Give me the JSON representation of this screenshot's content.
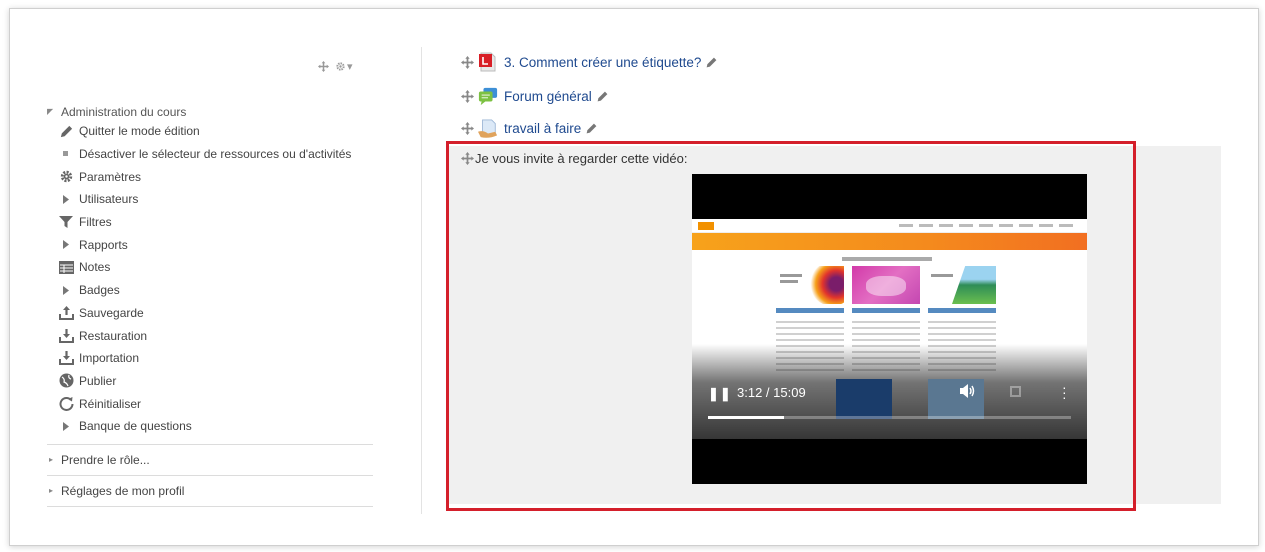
{
  "sidebar": {
    "section_title": "Administration du cours",
    "items": [
      {
        "label": "Quitter le mode édition",
        "icon": "pencil-icon"
      },
      {
        "label": "Désactiver le sélecteur de ressources ou d'activités",
        "icon": "bullet-icon"
      },
      {
        "label": "Paramètres",
        "icon": "gear-icon"
      },
      {
        "label": "Utilisateurs",
        "icon": "caret-right-icon"
      },
      {
        "label": "Filtres",
        "icon": "filter-icon"
      },
      {
        "label": "Rapports",
        "icon": "caret-right-icon"
      },
      {
        "label": "Notes",
        "icon": "grades-table-icon"
      },
      {
        "label": "Badges",
        "icon": "caret-right-icon"
      },
      {
        "label": "Sauvegarde",
        "icon": "upload-icon"
      },
      {
        "label": "Restauration",
        "icon": "download-icon"
      },
      {
        "label": "Importation",
        "icon": "download-icon"
      },
      {
        "label": "Publier",
        "icon": "globe-icon"
      },
      {
        "label": "Réinitialiser",
        "icon": "reset-icon"
      },
      {
        "label": "Banque de questions",
        "icon": "caret-right-icon"
      }
    ],
    "switch_role": "Prendre le rôle...",
    "profile_settings": "Réglages de mon profil"
  },
  "content": {
    "activities": [
      {
        "label": "3. Comment créer une étiquette?",
        "icon": "pdf-icon"
      },
      {
        "label": "Forum général",
        "icon": "forum-icon"
      },
      {
        "label": "travail à faire",
        "icon": "assignment-icon"
      }
    ],
    "label_text": "Je vous invite à regarder cette vidéo:",
    "video": {
      "time": "3:12 / 15:09",
      "progress": 0.21
    }
  },
  "colors": {
    "highlight": "#d41f2b",
    "link": "#1f4a8f"
  }
}
